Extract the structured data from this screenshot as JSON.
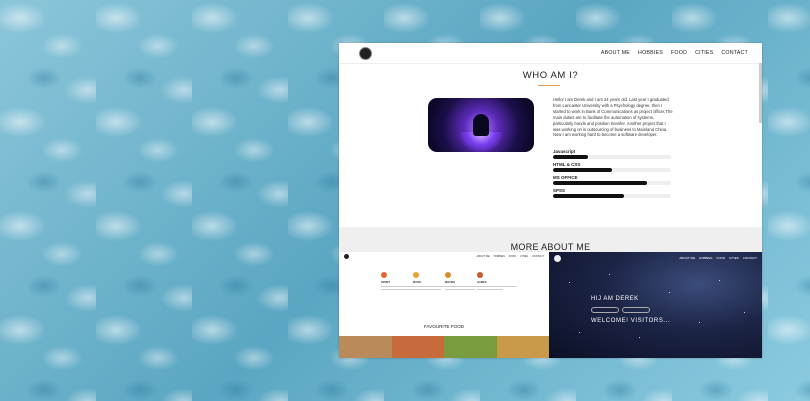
{
  "header": {
    "nav": [
      "ABOUT ME",
      "HOBBIES",
      "FOOD",
      "CITIES",
      "CONTACT"
    ]
  },
  "about": {
    "title": "WHO AM I?",
    "bio": "Hello! I am Derek and I am 24 years old. Last year I graduated from Lancaster University with a Psychology degree, then I started to work in Bank of Communications as project officer.The main duties are to facilitate the automation of systems, particularly bonds and position transfer. Another project that I was working on is outsourcing of business to Mainland China. Now I am working hard to become a software developer.",
    "skills": [
      {
        "name": "Javascript",
        "level": 0.3
      },
      {
        "name": "HTML & CSS",
        "level": 0.5
      },
      {
        "name": "MS OFFICE",
        "level": 0.8
      },
      {
        "name": "SPSS",
        "level": 0.6
      }
    ]
  },
  "more": {
    "title": "MORE ABOUT ME",
    "left_preview": {
      "nav": [
        "ABOUT ME",
        "HOBBIES",
        "FOOD",
        "CITIES",
        "CONTACT"
      ],
      "hobbies": [
        "SPORT",
        "MUSIC",
        "MOVIES",
        "GAMES"
      ],
      "hobby_colors": [
        "#e2672b",
        "#e8a23a",
        "#d98b2a",
        "#c85a2a"
      ],
      "favourite_title": "FAVOURITE FOOD",
      "food_colors": [
        "#b98a5a",
        "#c76a3c",
        "#7a9b3e",
        "#c99a4a"
      ]
    },
    "right_preview": {
      "nav": [
        "ABOUT ME",
        "HOBBIES",
        "FOOD",
        "CITIES",
        "CONTACT"
      ],
      "greeting": "HIJ AM DEREK",
      "welcome": "WELCOME! VISITORS..."
    }
  }
}
